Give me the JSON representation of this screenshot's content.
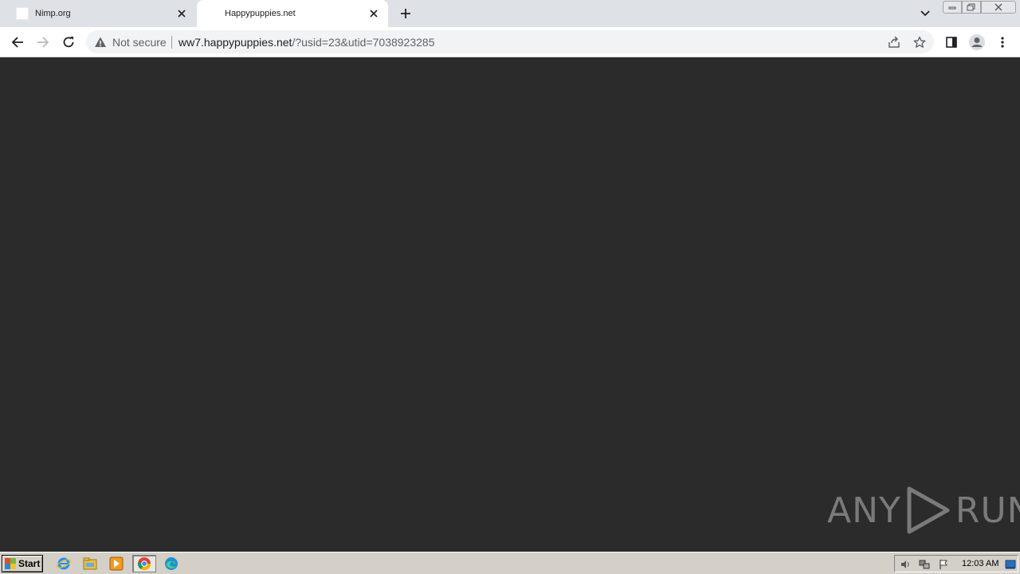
{
  "browser": {
    "tabs": [
      {
        "title": "Nimp.org",
        "active": false
      },
      {
        "title": "Happypuppies.net",
        "active": true
      }
    ],
    "omnibox": {
      "security_label": "Not secure",
      "url_host": "ww7.happypuppies.net",
      "url_rest": "/?usid=23&utid=7038923285"
    }
  },
  "content": {
    "background_color": "#2b2b2b",
    "watermark_text_left": "ANY",
    "watermark_text_right": "RUN"
  },
  "taskbar": {
    "start_label": "Start",
    "clock": "12:03 AM"
  }
}
